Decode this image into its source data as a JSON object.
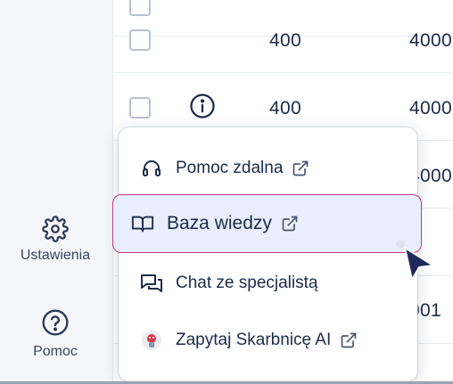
{
  "sidebar": {
    "items": [
      {
        "label": "Ustawienia",
        "icon": "gear-icon"
      },
      {
        "label": "Pomoc",
        "icon": "help-circle-icon"
      }
    ]
  },
  "table": {
    "rows": [
      {
        "c1": "400",
        "c2": "4000"
      },
      {
        "c1": "400",
        "c2": "4000"
      },
      {
        "c1": "",
        "c2": "4000"
      },
      {
        "c1": "",
        "c2": ""
      },
      {
        "c1": "",
        "c2": "001"
      }
    ]
  },
  "menu": {
    "items": [
      {
        "label": "Pomoc zdalna",
        "icon": "headset-icon",
        "external": true
      },
      {
        "label": "Baza wiedzy",
        "icon": "book-open-icon",
        "external": true,
        "active": true
      },
      {
        "label": "Chat ze specjalistą",
        "icon": "chat-bubbles-icon",
        "external": false
      },
      {
        "label": "Zapytaj Skarbnicę AI",
        "icon": "ai-avatar-icon",
        "external": true
      }
    ]
  },
  "colors": {
    "accent_border": "#c2368e",
    "active_bg": "#e8eefb",
    "text": "#1c2b4a"
  }
}
